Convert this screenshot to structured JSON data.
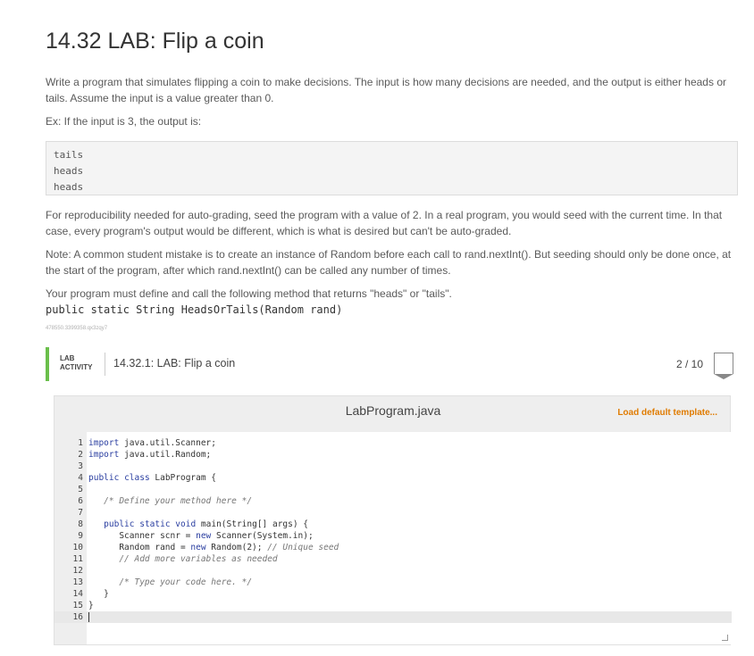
{
  "title": "14.32 LAB: Flip a coin",
  "intro": "Write a program that simulates flipping a coin to make decisions. The input is how many decisions are needed, and the output is either heads or tails. Assume the input is a value greater than 0.",
  "example_intro": "Ex: If the input is 3, the output is:",
  "sample_output": [
    "tails",
    "heads",
    "heads"
  ],
  "seed_note": "For reproducibility needed for auto-grading, seed the program with a value of 2. In a real program, you would seed with the current time. In that case, every program's output would be different, which is what is desired but can't be auto-graded.",
  "mistake_note": "Note: A common student mistake is to create an instance of Random before each call to rand.nextInt(). But seeding should only be done once, at the start of the program, after which rand.nextInt() can be called any number of times.",
  "method_intro": "Your program must define and call the following method that returns \"heads\" or \"tails\".",
  "method_signature": "public static String HeadsOrTails(Random rand)",
  "tracking_tag": "478550.3399358.qx3zqy7",
  "lab": {
    "badge_line1": "LAB",
    "badge_line2": "ACTIVITY",
    "title": "14.32.1: LAB: Flip a coin",
    "score": "2 / 10"
  },
  "editor": {
    "file_name": "LabProgram.java",
    "load_default": "Load default template...",
    "lines": [
      {
        "n": "1",
        "code": "import java.util.Scanner;"
      },
      {
        "n": "2",
        "code": "import java.util.Random;"
      },
      {
        "n": "3",
        "code": ""
      },
      {
        "n": "4",
        "code": "public class LabProgram {"
      },
      {
        "n": "5",
        "code": ""
      },
      {
        "n": "6",
        "code": "   /* Define your method here */"
      },
      {
        "n": "7",
        "code": ""
      },
      {
        "n": "8",
        "code": "   public static void main(String[] args) {"
      },
      {
        "n": "9",
        "code": "      Scanner scnr = new Scanner(System.in);"
      },
      {
        "n": "10",
        "code": "      Random rand = new Random(2); // Unique seed"
      },
      {
        "n": "11",
        "code": "      // Add more variables as needed"
      },
      {
        "n": "12",
        "code": ""
      },
      {
        "n": "13",
        "code": "      /* Type your code here. */"
      },
      {
        "n": "14",
        "code": "   }"
      },
      {
        "n": "15",
        "code": "}"
      },
      {
        "n": "16",
        "code": ""
      }
    ]
  }
}
